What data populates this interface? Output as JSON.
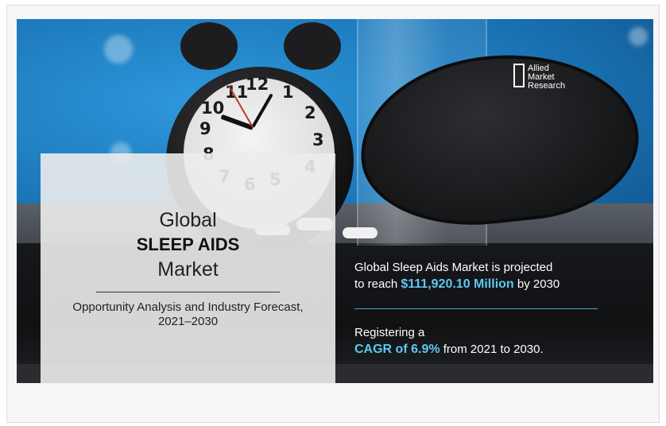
{
  "brand": {
    "logo_lines": [
      "Allied",
      "Market",
      "Research"
    ]
  },
  "clock_numbers": [
    "12",
    "1",
    "2",
    "3",
    "4",
    "5",
    "6",
    "7",
    "8",
    "9",
    "10",
    "11"
  ],
  "overlay": {
    "line1": "Global",
    "line2": "SLEEP AIDS",
    "line3": "Market",
    "subtitle_line1": "Opportunity Analysis and Industry Forecast,",
    "subtitle_line2": "2021–2030"
  },
  "stats": {
    "projection_pre": "Global Sleep Aids Market is projected",
    "projection_to": "to reach ",
    "projection_value": "$111,920.10 Million",
    "projection_post": " by 2030",
    "cagr_pre": "Registering a",
    "cagr_value": "CAGR of 6.9%",
    "cagr_post": " from 2021 to 2030."
  },
  "colors": {
    "highlight": "#5ec8f2",
    "background_blue": "#1f7fc2",
    "overlay": "#ececec"
  }
}
